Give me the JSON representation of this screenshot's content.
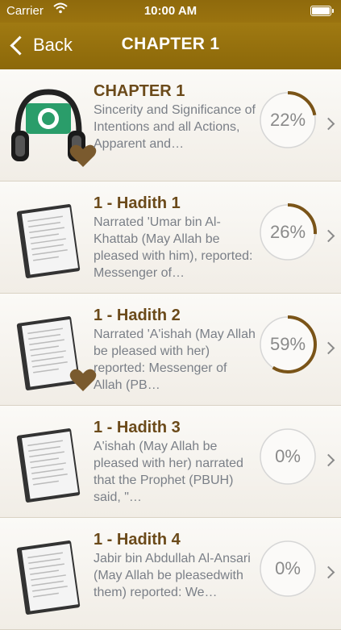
{
  "status_bar": {
    "carrier": "Carrier",
    "time": "10:00 AM"
  },
  "nav": {
    "back_label": "Back",
    "title": "CHAPTER 1"
  },
  "colors": {
    "accent": "#9a730f",
    "title_text": "#6b4a1a",
    "progress": "#7a5418",
    "heart": "#7a5a2e"
  },
  "rows": [
    {
      "title": "CHAPTER 1",
      "description": "Sincerity and Significance of Intentions and all Actions, Apparent and…",
      "progress": 22,
      "progress_label": "22%",
      "favorite": true,
      "icon": "headphones-icon"
    },
    {
      "title": "1 - Hadith 1",
      "description": " Narrated 'Umar bin Al-Khattab (May Allah be pleased with him), reported: Messenger of…",
      "progress": 26,
      "progress_label": "26%",
      "favorite": false,
      "icon": "document-icon"
    },
    {
      "title": "1 - Hadith 2",
      "description": " Narrated 'A'ishah (May Allah be pleased with her) reported: Messenger of Allah (PB…",
      "progress": 59,
      "progress_label": "59%",
      "favorite": true,
      "icon": "document-icon"
    },
    {
      "title": "1 - Hadith 3",
      "description": " A'ishah (May Allah be pleased with her) narrated that the Prophet (PBUH) said, \"…",
      "progress": 0,
      "progress_label": "0%",
      "favorite": false,
      "icon": "document-icon"
    },
    {
      "title": "1 - Hadith 4",
      "description": " Jabir bin Abdullah Al-Ansari (May Allah be pleasedwith them) reported: We…",
      "progress": 0,
      "progress_label": "0%",
      "favorite": false,
      "icon": "document-icon"
    }
  ]
}
